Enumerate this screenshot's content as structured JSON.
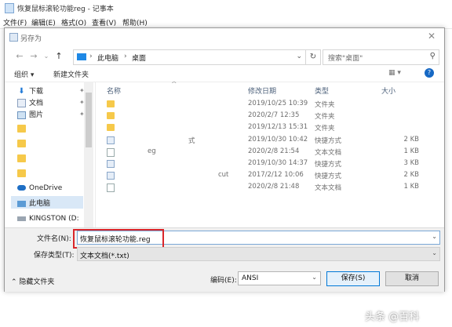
{
  "notepad": {
    "title": "恢复鼠标滚轮功能reg - 记事本",
    "menu": [
      "文件(F)",
      "编辑(E)",
      "格式(O)",
      "查看(V)",
      "帮助(H)"
    ]
  },
  "dialog": {
    "title": "另存为",
    "address": [
      "此电脑",
      "桌面"
    ],
    "search_placeholder": "搜索\"桌面\"",
    "toolbar": {
      "organize": "组织 ▾",
      "new_folder": "新建文件夹"
    },
    "sidebar": [
      {
        "label": "下载",
        "icon": "download-icon"
      },
      {
        "label": "文档",
        "icon": "document-icon"
      },
      {
        "label": "图片",
        "icon": "picture-icon"
      },
      {
        "label": "",
        "icon": "folder-icon"
      },
      {
        "label": "",
        "icon": "folder-icon"
      },
      {
        "label": "",
        "icon": "folder-icon"
      },
      {
        "label": "",
        "icon": "folder-icon"
      },
      {
        "label": "OneDrive",
        "icon": "cloud-icon"
      },
      {
        "label": "此电脑",
        "icon": "computer-icon"
      },
      {
        "label": "KINGSTON (D:",
        "icon": "drive-icon"
      }
    ],
    "columns": [
      "名称",
      "修改日期",
      "类型",
      "大小"
    ],
    "files": [
      {
        "name": "",
        "date": "2019/10/25 10:39",
        "type": "文件夹",
        "size": "",
        "kind": "folder"
      },
      {
        "name": "",
        "date": "2020/2/7 12:35",
        "type": "文件夹",
        "size": "",
        "kind": "folder"
      },
      {
        "name": "",
        "date": "2019/12/13 15:31",
        "type": "文件夹",
        "size": "",
        "kind": "folder"
      },
      {
        "name": "式",
        "date": "2019/10/30 10:42",
        "type": "快捷方式",
        "size": "2 KB",
        "kind": "lnk"
      },
      {
        "name": "eg",
        "date": "2020/2/8 21:54",
        "type": "文本文档",
        "size": "1 KB",
        "kind": "txt"
      },
      {
        "name": "",
        "date": "2019/10/30 14:37",
        "type": "快捷方式",
        "size": "3 KB",
        "kind": "lnk"
      },
      {
        "name": "cut",
        "date": "2017/2/12 10:06",
        "type": "快捷方式",
        "size": "2 KB",
        "kind": "lnk"
      },
      {
        "name": "",
        "date": "2020/2/8 21:48",
        "type": "文本文档",
        "size": "1 KB",
        "kind": "txt"
      }
    ],
    "filename_label": "文件名(N):",
    "filename_value": "恢复鼠标滚轮功能.reg",
    "filetype_label": "保存类型(T):",
    "filetype_value": "文本文档(*.txt)",
    "hide_folders": "隐藏文件夹",
    "encoding_label": "编码(E):",
    "encoding_value": "ANSI",
    "save": "保存(S)",
    "cancel": "取消"
  },
  "watermark": "头条 @百科"
}
